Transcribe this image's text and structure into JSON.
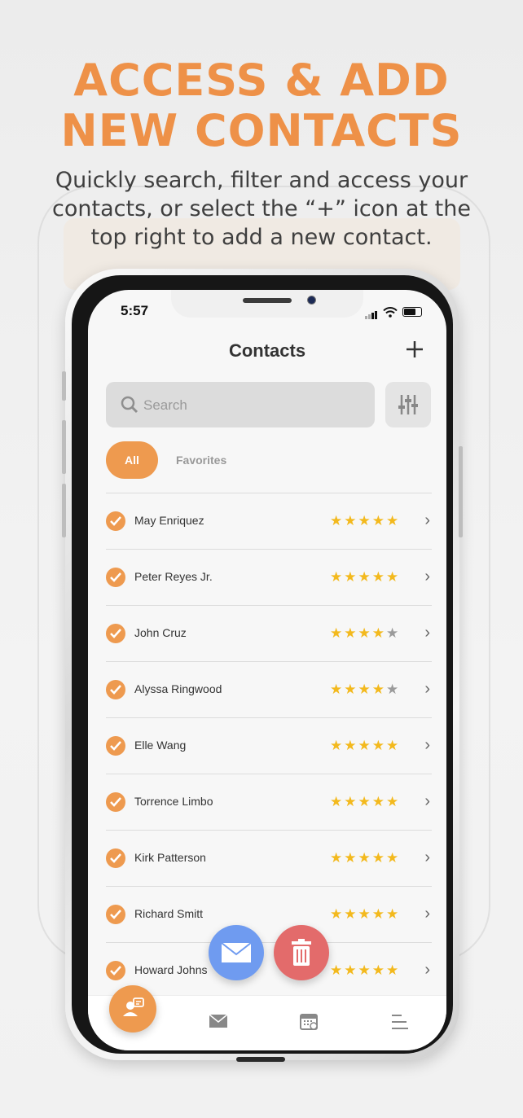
{
  "hero": {
    "headline_line1": "ACCESS & ADD",
    "headline_line2": "NEW CONTACTS",
    "subtitle": "Quickly search, filter and access your contacts, or select the “+” icon at the top right to add a new contact."
  },
  "status_bar": {
    "time": "5:57"
  },
  "header": {
    "title": "Contacts",
    "add_icon": "plus-icon"
  },
  "search": {
    "placeholder": "Search",
    "icon": "search-icon",
    "filter_icon": "sliders-icon"
  },
  "tabs": {
    "all": "All",
    "favorites": "Favorites",
    "active": "All"
  },
  "contacts": [
    {
      "name": "May Enriquez",
      "rating": 5
    },
    {
      "name": "Peter Reyes Jr.",
      "rating": 5
    },
    {
      "name": "John Cruz",
      "rating": 4
    },
    {
      "name": "Alyssa  Ringwood",
      "rating": 4
    },
    {
      "name": "Elle Wang",
      "rating": 5
    },
    {
      "name": "Torrence Limbo",
      "rating": 5
    },
    {
      "name": "Kirk Patterson",
      "rating": 5
    },
    {
      "name": "Richard Smitt",
      "rating": 5
    },
    {
      "name": "Howard Johns",
      "rating": 5
    }
  ],
  "colors": {
    "accent": "#ee9a4f",
    "headline": "#ee9148",
    "star": "#f3b91d",
    "mail_fab": "#6f9bf0",
    "trash_fab": "#e36b6b"
  },
  "tab_bar": {
    "icons": [
      "contacts-icon",
      "mail-icon",
      "calendar-icon",
      "menu-icon"
    ]
  }
}
